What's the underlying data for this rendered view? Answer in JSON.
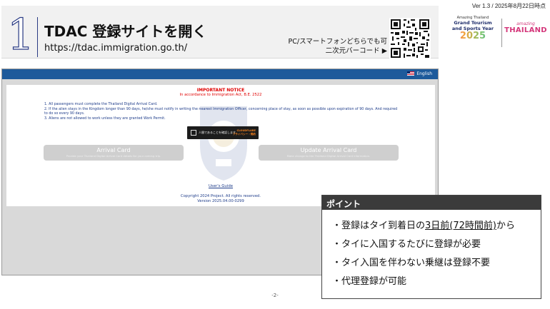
{
  "version": "Ver 1.3 / 2025年8月22日時点",
  "header": {
    "step": "1",
    "title": "TDAC 登録サイトを開く",
    "url": "https://tdac.immigration.go.th/",
    "qr_caption_line1": "PC/スマートフォンどちらでも可",
    "qr_caption_line2": "二次元バーコード ▶"
  },
  "logo": {
    "amazing_small": "Amazing Thailand",
    "grand_line1": "Grand Tourism",
    "grand_line2": "and Sports Year",
    "year": "2025",
    "amazing_script": "amazing",
    "thailand": "THAILAND"
  },
  "screen": {
    "lang_label": "English",
    "notice_title": "IMPORTANT NOTICE",
    "notice_sub": "In accordance to Immigration Act, B.E. 2522",
    "rules": [
      "1. All passengers must complete the Thailand Digital Arrival Card.",
      "2. If the alien stays in the Kingdom longer than 90 days, he/she must notify in writing the nearest Immigration Officer, concerning place of stay, as soon as possible upon expiration of 90 days. And required to do so every 90 days.",
      "3. Aliens are not allowed to work unless they are granted Work Permit."
    ],
    "captcha_label": "人間であることを確認します",
    "captcha_brand_1": "CLOUDFLARE",
    "captcha_brand_2": "プライバシー・規約",
    "arrival_title": "Arrival Card",
    "arrival_desc": "Provide your Thailand Digital Arrival Card details for your coming trip.",
    "update_title": "Update Arrival Card",
    "update_desc": "Make change to the Thailand Digital Arrival Card information.",
    "users_guide": "User's Guide",
    "copyright": "Copyright 2024 Project. All rights reserved.",
    "build_version": "Version 2025.04.00-0299"
  },
  "points": {
    "heading": "ポイント",
    "item1_pre": "・登録はタイ到着日の",
    "item1_ul": "3日前(72時間前)",
    "item1_post": "から",
    "item2": "・タイに入国するたびに登録が必要",
    "item3": "・タイ入国を伴わない乗継は登録不要",
    "item4": "・代理登録が可能"
  },
  "page_number": "-2-",
  "colors": {
    "accent_navy": "#2a3b84",
    "site_topbar": "#1d5a9b",
    "notice_red": "#e00000",
    "point_header": "#3b3b3b"
  }
}
